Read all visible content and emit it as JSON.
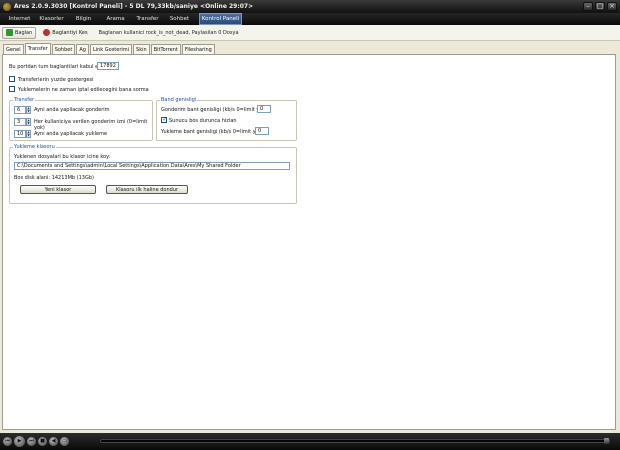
{
  "titlebar": {
    "text": "Ares 2.0.9.3030  [Kontrol Paneli]   - 5 DL 79,33kb/saniye  <Online 29:07>"
  },
  "menu": [
    {
      "label": "Internet"
    },
    {
      "label": "Klasorler"
    },
    {
      "label": "Bilgin"
    },
    {
      "label": "Arama"
    },
    {
      "label": "Transfer"
    },
    {
      "label": "Sohbet"
    },
    {
      "label": "Kontrol Paneli",
      "active": true
    }
  ],
  "toolbar": {
    "connect_label": "Baglan",
    "disconnect_label": "Baglantiyi Kes",
    "status_text": "Baglanan kullanici rock_is_not_dead, Paylasilan 0 Dosya"
  },
  "tabs": [
    "Genel",
    "Transfer",
    "Sohbet",
    "Ag",
    "Link Gosterimi",
    "Skin",
    "BitTorrent",
    "Filesharing"
  ],
  "transfer_settings": {
    "port_label": "Bu portdan tum baglantilari kabul et:",
    "port_value": "17892",
    "show_percent_label": "Transferlerin yuzde gostergesi",
    "show_percent_checked": false,
    "confirm_cancel_label": "Yuklemelerin ne zaman iptal edilecegini bana sorma",
    "confirm_cancel_checked": false
  },
  "transfer_group": {
    "title": "Transfer",
    "max_downloads_value": "6",
    "max_downloads_label": "Ayni anda yapilacak gonderim",
    "per_user_value": "3",
    "per_user_label": "Her kullaniciya verilen gonderim izni (0=limit yok)",
    "max_uploads_value": "10",
    "max_uploads_label": "Ayni anda yapilacak yukleme"
  },
  "bandwidth_group": {
    "title": "Band genisligi",
    "upload_limit_label": "Gonderim bant genisligi (kb/s 0=limit yok)",
    "upload_limit_value": "0",
    "server_idle_label": "Sunucu bos durunca hizlan",
    "server_idle_checked": true,
    "download_limit_label": "Yukleme bant genisligi (kb/s 0=limit yok)",
    "download_limit_value": "0"
  },
  "download_folder": {
    "title": "Yukleme klasoru",
    "prompt": "Yuklenen dosyalari bu klasor icine koy:",
    "path": "C:\\Documents and Settings\\admin\\Local Settings\\Application Data\\Ares\\My Shared Folder",
    "free_space": "Bos disk alani: 14213Mb (13Gb)",
    "new_folder_button": "Yeni klasor",
    "reset_button": "Klasoru ilk haline dondur"
  },
  "player": {
    "icons": [
      "skip-back-icon",
      "play-icon",
      "skip-forward-icon",
      "stop-icon",
      "volume-icon",
      "playlist-icon"
    ]
  },
  "colors": {
    "active_menu": "#3b5e93",
    "group_title": "#1c4fa0",
    "window_bg": "#ece9d8"
  }
}
